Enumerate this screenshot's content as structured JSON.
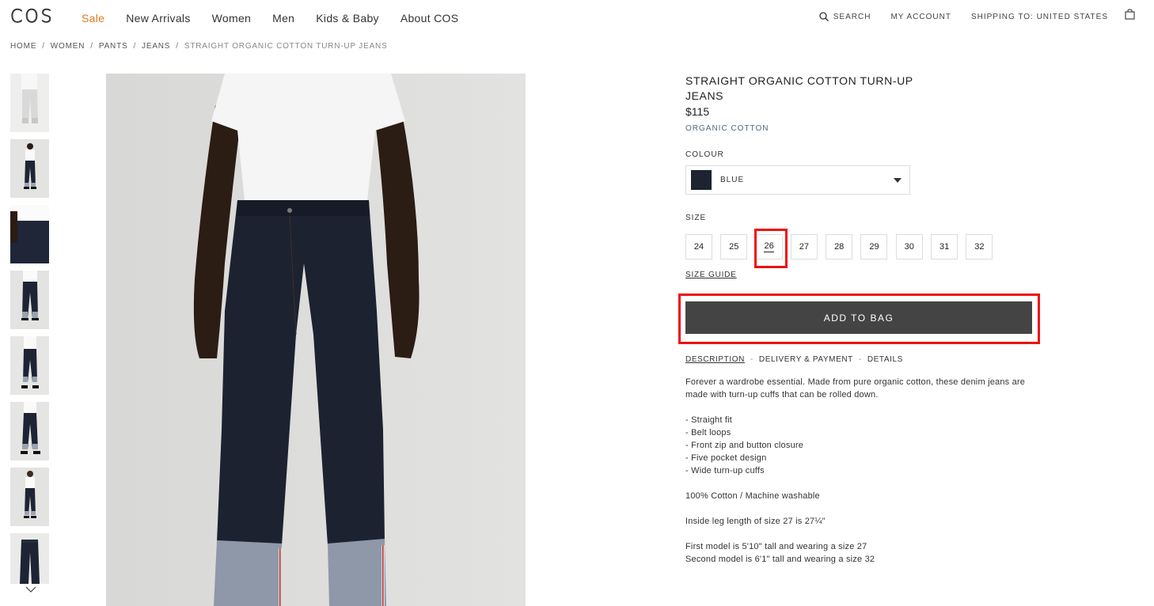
{
  "header": {
    "logo": "COS",
    "nav": [
      "Sale",
      "New Arrivals",
      "Women",
      "Men",
      "Kids & Baby",
      "About COS"
    ],
    "search_label": "SEARCH",
    "account_label": "MY ACCOUNT",
    "shipping_label": "SHIPPING TO: UNITED STATES",
    "accent_color": "#e07a22"
  },
  "breadcrumb": [
    "HOME",
    "WOMEN",
    "PANTS",
    "JEANS",
    "STRAIGHT ORGANIC COTTON TURN-UP JEANS"
  ],
  "product": {
    "title": "STRAIGHT ORGANIC COTTON TURN-UP JEANS",
    "price": "$115",
    "material": "ORGANIC COTTON",
    "colour_label": "COLOUR",
    "colour_value": "BLUE",
    "swatch_color": "#1d2330",
    "size_label": "SIZE",
    "sizes": [
      "24",
      "25",
      "26",
      "27",
      "28",
      "29",
      "30",
      "31",
      "32"
    ],
    "selected_size": "26",
    "size_guide": "SIZE GUIDE",
    "add_to_bag": "ADD TO BAG",
    "tabs": [
      "DESCRIPTION",
      "DELIVERY & PAYMENT",
      "DETAILS"
    ],
    "description_intro": "Forever a wardrobe essential. Made from pure organic cotton, these denim jeans are made with turn-up cuffs that can be rolled down.",
    "features": [
      "- Straight fit",
      "- Belt loops",
      "- Front zip and button closure",
      "- Five pocket design",
      "- Wide turn-up cuffs"
    ],
    "composition": "100% Cotton / Machine washable",
    "leg_length": "Inside leg length of size 27 is 27¼\"",
    "model_1": "First model is 5'10\" tall and wearing a size 27",
    "model_2": "Second model is 6'1\" tall and wearing a size 32"
  }
}
